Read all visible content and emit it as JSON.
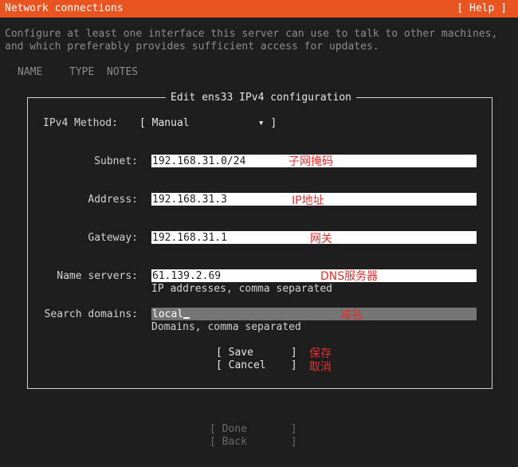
{
  "header": {
    "title": "Network connections",
    "help": "[ Help ]"
  },
  "description": {
    "line1": "Configure at least one interface this server can use to talk to other machines,",
    "line2": "and which preferably provides sufficient access for updates."
  },
  "columns": [
    "NAME",
    "TYPE",
    "NOTES"
  ],
  "dialog": {
    "title": "Edit ens33 IPv4 configuration",
    "method_label": "IPv4 Method:",
    "method_value": "[ Manual           ▾ ]",
    "fields": {
      "subnet": {
        "label": "Subnet:",
        "value": "192.168.31.0/24",
        "note": "子网掩码"
      },
      "address": {
        "label": "Address:",
        "value": "192.168.31.3",
        "note": "IP地址"
      },
      "gateway": {
        "label": "Gateway:",
        "value": "192.168.31.1",
        "note": "网关"
      },
      "name_servers": {
        "label": "Name servers:",
        "value": "61.139.2.69",
        "hint": "IP addresses, comma separated",
        "note": "DNS服务器"
      },
      "search_domains": {
        "label": "Search domains:",
        "value": "local",
        "hint": "Domains, comma separated",
        "note": "域名"
      }
    },
    "save": "[ Save      ]",
    "save_note": "保存",
    "cancel": "[ Cancel    ]",
    "cancel_note": "取消"
  },
  "footer": {
    "done": "[ Done       ]",
    "back": "[ Back       ]"
  },
  "colors": {
    "accent": "#e95420",
    "background": "#1e1e1e",
    "annotation": "#e62e2e"
  }
}
